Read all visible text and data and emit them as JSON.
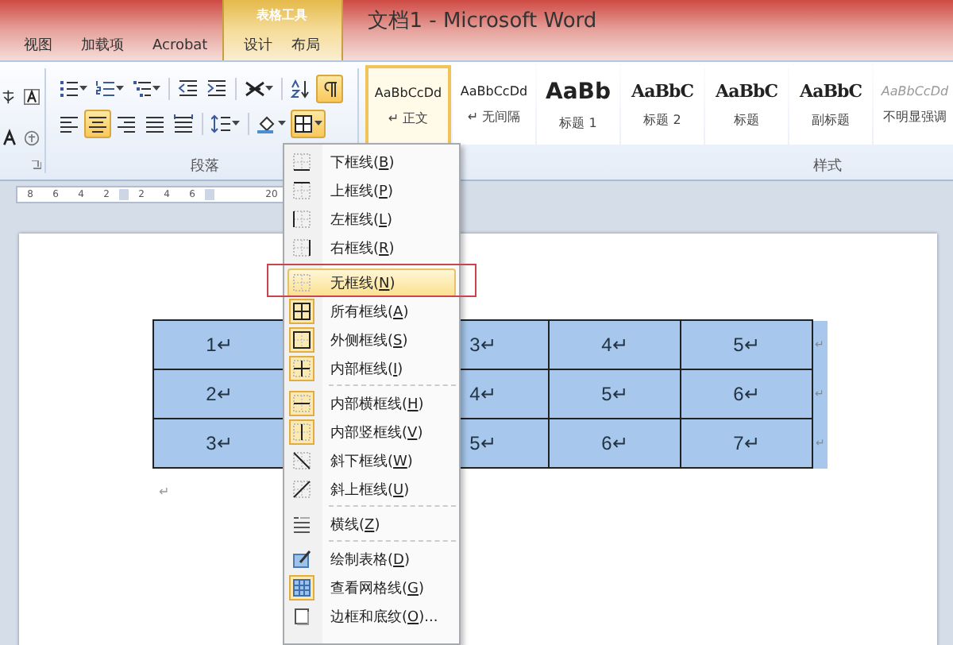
{
  "window": {
    "title": "文档1 - Microsoft Word"
  },
  "contextual_tab_group": {
    "label": "表格工具"
  },
  "tabs": [
    {
      "label": "视图",
      "contextual": false
    },
    {
      "label": "加载项",
      "contextual": false
    },
    {
      "label": "Acrobat",
      "contextual": false
    },
    {
      "label": "设计",
      "contextual": true
    },
    {
      "label": "布局",
      "contextual": true
    }
  ],
  "ribbon": {
    "font_group_buttons": [
      {
        "selected": false
      },
      {
        "selected": false
      },
      {
        "selected": false
      },
      {
        "selected": false
      }
    ],
    "paragraph_group": {
      "label": "段落",
      "buttons": [
        {
          "selected": false
        },
        {
          "selected": false
        },
        {
          "selected": false
        },
        {
          "selected": false
        },
        {
          "selected": false
        },
        {
          "selected": false
        },
        {
          "selected": false
        },
        {
          "selected": true
        },
        {
          "selected": false
        },
        {
          "selected": true
        },
        {
          "selected": false
        },
        {
          "selected": false
        },
        {
          "selected": false
        },
        {
          "selected": false
        },
        {
          "selected": false
        },
        {
          "selected": true
        }
      ]
    },
    "styles_group": {
      "label": "样式",
      "styles": [
        {
          "sample": "AaBbCcDd",
          "name": "↵ 正文",
          "kind": "normal",
          "selected": true
        },
        {
          "sample": "AaBbCcDd",
          "name": "↵ 无间隔",
          "kind": "normal",
          "selected": false
        },
        {
          "sample": "AaBb",
          "name": "标题 1",
          "kind": "heading1",
          "selected": false
        },
        {
          "sample": "AaBbC",
          "name": "标题 2",
          "kind": "heading2",
          "selected": false
        },
        {
          "sample": "AaBbC",
          "name": "标题",
          "kind": "heading2",
          "selected": false
        },
        {
          "sample": "AaBbC",
          "name": "副标题",
          "kind": "heading2",
          "selected": false
        },
        {
          "sample": "AaBbCcDd",
          "name": "不明显强调",
          "kind": "subtle",
          "selected": false
        }
      ]
    }
  },
  "ruler": {
    "labels": [
      "8",
      "6",
      "4",
      "2",
      "2",
      "4",
      "6",
      "20"
    ]
  },
  "document": {
    "table": {
      "rows": [
        [
          "1↵",
          null,
          "3↵",
          "4↵",
          "5↵"
        ],
        [
          "2↵",
          null,
          "4↵",
          "5↵",
          "6↵"
        ],
        [
          "3↵",
          null,
          "5↵",
          "6↵",
          "7↵"
        ]
      ],
      "row_end_marks": [
        "↵",
        "↵",
        "↵"
      ]
    },
    "paragraph_mark": "↵"
  },
  "border_menu": {
    "groups": [
      [
        {
          "label": "下框线(B)",
          "checked": false,
          "selected": false
        },
        {
          "label": "上框线(P)",
          "checked": false,
          "selected": false
        },
        {
          "label": "左框线(L)",
          "checked": false,
          "selected": false
        },
        {
          "label": "右框线(R)",
          "checked": false,
          "selected": false
        }
      ],
      [
        {
          "label": "无框线(N)",
          "checked": false,
          "selected": true
        },
        {
          "label": "所有框线(A)",
          "checked": true,
          "selected": false
        },
        {
          "label": "外侧框线(S)",
          "checked": true,
          "selected": false
        },
        {
          "label": "内部框线(I)",
          "checked": true,
          "selected": false
        }
      ],
      [
        {
          "label": "内部横框线(H)",
          "checked": true,
          "selected": false
        },
        {
          "label": "内部竖框线(V)",
          "checked": true,
          "selected": false
        },
        {
          "label": "斜下框线(W)",
          "checked": false,
          "selected": false
        },
        {
          "label": "斜上框线(U)",
          "checked": false,
          "selected": false
        }
      ],
      [
        {
          "label": "横线(Z)",
          "checked": false,
          "selected": false
        }
      ],
      [
        {
          "label": "绘制表格(D)",
          "checked": false,
          "selected": false
        },
        {
          "label": "查看网格线(G)",
          "checked": true,
          "selected": false
        },
        {
          "label": "边框和底纹(O)...",
          "checked": false,
          "selected": false
        }
      ]
    ]
  }
}
